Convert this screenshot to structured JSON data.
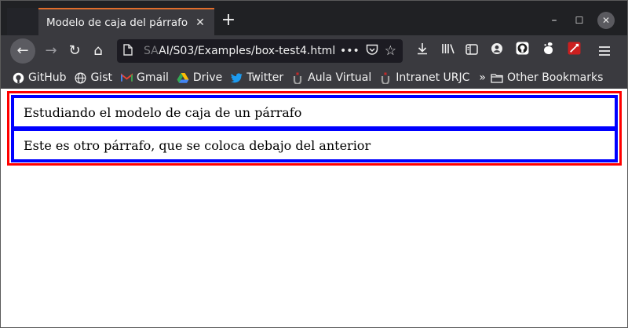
{
  "browser": {
    "tab": {
      "title": "Modelo de caja del párrafo",
      "close_glyph": "✕"
    },
    "new_tab_glyph": "+",
    "window_controls": {
      "minimize": "–",
      "maximize": "☐",
      "close": "✕"
    },
    "nav": {
      "back_glyph": "←",
      "forward_glyph": "→",
      "reload_glyph": "↻",
      "home_glyph": "⌂"
    },
    "url": {
      "faded_prefix": "SA",
      "text": "AI/S03/Examples/box-test4.html",
      "page_icon": "page-icon",
      "more_glyph": "•••",
      "pocket_glyph": "◡",
      "bookmark_glyph": "☆"
    },
    "toolbar_icons": [
      "download-icon",
      "library-icon",
      "sidebar-icon",
      "account-icon",
      "github-icon",
      "gnome-icon",
      "extension-icon",
      "menu-icon"
    ],
    "bookmarks": [
      {
        "label": "GitHub",
        "icon": "github-icon"
      },
      {
        "label": "Gist",
        "icon": "globe-icon"
      },
      {
        "label": "Gmail",
        "icon": "gmail-icon"
      },
      {
        "label": "Drive",
        "icon": "drive-icon"
      },
      {
        "label": "Twitter",
        "icon": "twitter-icon"
      },
      {
        "label": "Aula Virtual",
        "icon": "urjc-icon"
      },
      {
        "label": "Intranet URJC",
        "icon": "urjc-icon"
      }
    ],
    "bookmarks_overflow_glyph": "»",
    "other_bookmarks": {
      "label": "Other Bookmarks",
      "icon": "folder-icon"
    }
  },
  "page": {
    "paragraphs": [
      "Estudiando el modelo de caja de un párrafo",
      "Este es otro párrafo, que se coloca debajo del anterior"
    ]
  },
  "colors": {
    "body_border": "#ff0000",
    "paragraph_border": "#0000ff",
    "tab_accent": "#e06c2a"
  }
}
